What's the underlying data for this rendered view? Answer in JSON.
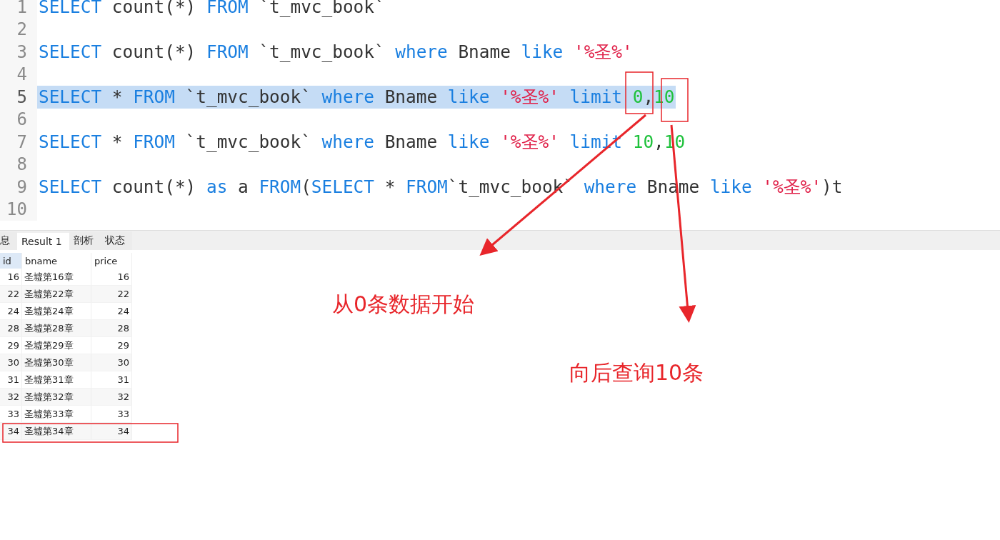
{
  "editor": {
    "lines": [
      {
        "number": "1",
        "selected": false,
        "tokens": [
          {
            "kind": "kw",
            "text": "SELECT"
          },
          {
            "kind": "plain",
            "text": " count(*) "
          },
          {
            "kind": "kw",
            "text": "FROM"
          },
          {
            "kind": "plain",
            "text": " `t_mvc_book`"
          }
        ]
      },
      {
        "number": "2",
        "selected": false
      },
      {
        "number": "3",
        "selected": false,
        "tokens": [
          {
            "kind": "kw",
            "text": "SELECT"
          },
          {
            "kind": "plain",
            "text": " count(*) "
          },
          {
            "kind": "kw",
            "text": "FROM"
          },
          {
            "kind": "plain",
            "text": " `t_mvc_book` "
          },
          {
            "kind": "kw",
            "text": "where"
          },
          {
            "kind": "plain",
            "text": " Bname "
          },
          {
            "kind": "kw",
            "text": "like"
          },
          {
            "kind": "str",
            "text": " '%圣%'"
          }
        ]
      },
      {
        "number": "4",
        "selected": false
      },
      {
        "number": "5",
        "selected": true,
        "tokens": [
          {
            "kind": "kw",
            "text": "SELECT"
          },
          {
            "kind": "plain",
            "text": " * "
          },
          {
            "kind": "kw",
            "text": "FROM"
          },
          {
            "kind": "plain",
            "text": " `t_mvc_book` "
          },
          {
            "kind": "kw",
            "text": "where"
          },
          {
            "kind": "plain",
            "text": " Bname "
          },
          {
            "kind": "kw",
            "text": "like"
          },
          {
            "kind": "str",
            "text": " '%圣%'"
          },
          {
            "kind": "kw",
            "text": " limit"
          },
          {
            "kind": "num",
            "text": " 0"
          },
          {
            "kind": "plain",
            "text": ","
          },
          {
            "kind": "num",
            "text": "10"
          }
        ]
      },
      {
        "number": "6",
        "selected": false
      },
      {
        "number": "7",
        "selected": false,
        "tokens": [
          {
            "kind": "kw",
            "text": "SELECT"
          },
          {
            "kind": "plain",
            "text": " * "
          },
          {
            "kind": "kw",
            "text": "FROM"
          },
          {
            "kind": "plain",
            "text": " `t_mvc_book` "
          },
          {
            "kind": "kw",
            "text": "where"
          },
          {
            "kind": "plain",
            "text": " Bname "
          },
          {
            "kind": "kw",
            "text": "like"
          },
          {
            "kind": "str",
            "text": " '%圣%'"
          },
          {
            "kind": "kw",
            "text": " limit"
          },
          {
            "kind": "num",
            "text": " 10"
          },
          {
            "kind": "plain",
            "text": ","
          },
          {
            "kind": "num",
            "text": "10"
          }
        ]
      },
      {
        "number": "8",
        "selected": false
      },
      {
        "number": "9",
        "selected": false,
        "tokens": [
          {
            "kind": "kw",
            "text": "SELECT"
          },
          {
            "kind": "plain",
            "text": " count(*) "
          },
          {
            "kind": "kw",
            "text": "as"
          },
          {
            "kind": "plain",
            "text": " a "
          },
          {
            "kind": "kw",
            "text": "FROM"
          },
          {
            "kind": "plain",
            "text": "("
          },
          {
            "kind": "kw",
            "text": "SELECT"
          },
          {
            "kind": "plain",
            "text": " * "
          },
          {
            "kind": "kw",
            "text": "FROM"
          },
          {
            "kind": "plain",
            "text": "`t_mvc_book` "
          },
          {
            "kind": "kw",
            "text": "where"
          },
          {
            "kind": "plain",
            "text": " Bname "
          },
          {
            "kind": "kw",
            "text": "like"
          },
          {
            "kind": "str",
            "text": " '%圣%'"
          },
          {
            "kind": "plain",
            "text": ")t"
          }
        ]
      },
      {
        "number": "10",
        "selected": false
      }
    ]
  },
  "results": {
    "tabs": [
      {
        "label": "息",
        "selected": false
      },
      {
        "label": "Result 1",
        "selected": true
      },
      {
        "label": "剖析",
        "selected": false
      },
      {
        "label": "状态",
        "selected": false
      }
    ],
    "table": {
      "columns": [
        {
          "label": "id",
          "selected": true
        },
        {
          "label": "bname",
          "selected": false
        },
        {
          "label": "price",
          "selected": false
        }
      ],
      "rows": [
        [
          "16",
          "圣墟第16章",
          "16"
        ],
        [
          "22",
          "圣墟第22章",
          "22"
        ],
        [
          "24",
          "圣墟第24章",
          "24"
        ],
        [
          "28",
          "圣墟第28章",
          "28"
        ],
        [
          "29",
          "圣墟第29章",
          "29"
        ],
        [
          "30",
          "圣墟第30章",
          "30"
        ],
        [
          "31",
          "圣墟第31章",
          "31"
        ],
        [
          "32",
          "圣墟第32章",
          "32"
        ],
        [
          "33",
          "圣墟第33章",
          "33"
        ],
        [
          "34",
          "圣墟第34章",
          "34"
        ]
      ]
    }
  },
  "annotations": [
    {
      "text": "从0条数据开始"
    },
    {
      "text": "向后查询10条"
    }
  ]
}
